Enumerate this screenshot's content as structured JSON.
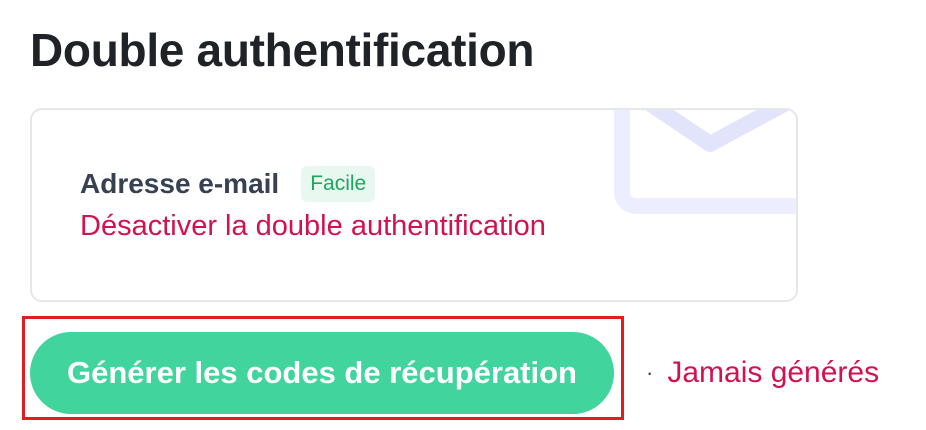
{
  "page": {
    "title": "Double authentification"
  },
  "method_card": {
    "method_label": "Adresse e-mail",
    "difficulty_badge": "Facile",
    "disable_link": "Désactiver la double authentification",
    "illustration_icon": "envelope-icon"
  },
  "recovery": {
    "generate_button_label": "Générer les codes de récupération",
    "separator": "·",
    "status_text": "Jamais générés"
  },
  "colors": {
    "title": "#1f2328",
    "label": "#374151",
    "badge_bg": "#e8f7ef",
    "badge_text": "#1fa65f",
    "link": "#d4114f",
    "button_bg": "#41d49c",
    "button_text": "#ffffff",
    "highlight": "#e11d1d"
  }
}
